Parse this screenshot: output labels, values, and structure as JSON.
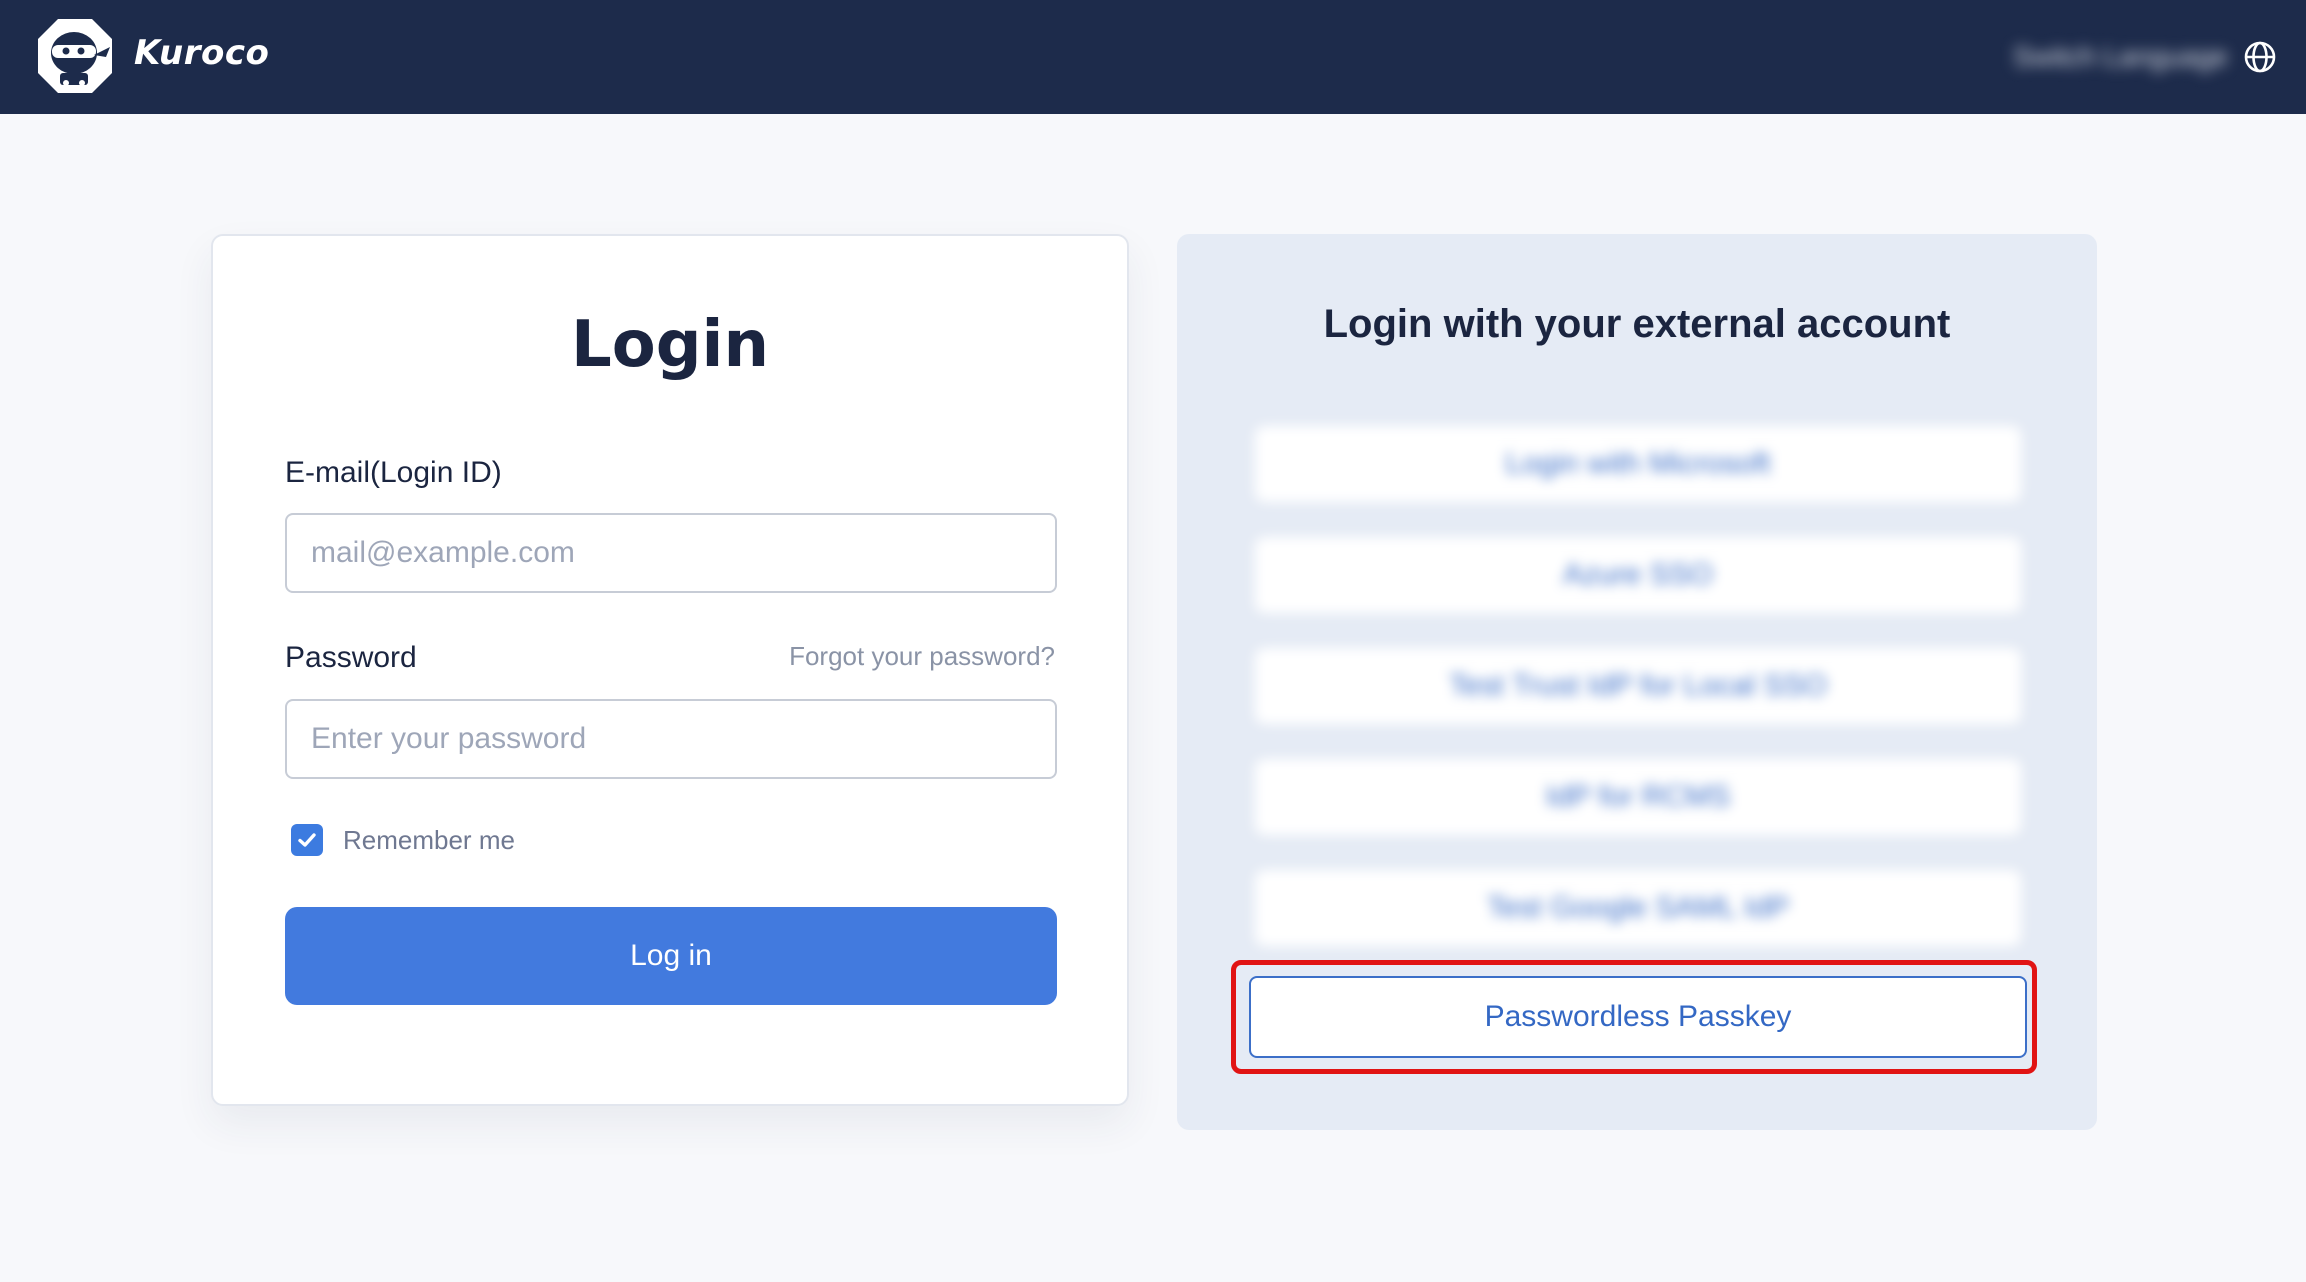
{
  "header": {
    "brand": "Kuroco",
    "language_label": "Switch Language"
  },
  "login": {
    "title": "Login",
    "email_label": "E-mail(Login ID)",
    "email_placeholder": "mail@example.com",
    "email_value": "",
    "password_label": "Password",
    "forgot_link": "Forgot your password?",
    "password_placeholder": "Enter your password",
    "password_value": "",
    "remember_label": "Remember me",
    "remember_checked": true,
    "submit_label": "Log in"
  },
  "external": {
    "title": "Login with your external account",
    "providers": [
      {
        "label": "Login with Microsoft"
      },
      {
        "label": "Azure SSO"
      },
      {
        "label": "Test Trust IdP for Local SSO"
      },
      {
        "label": "IdP for RCMS"
      },
      {
        "label": "Test Google SAML IdP"
      }
    ],
    "passkey_label": "Passwordless Passkey"
  },
  "colors": {
    "header_bg": "#1d2b4b",
    "primary": "#427ade",
    "highlight": "#e11414"
  },
  "icons": {
    "logo": "ninja-logo-icon",
    "language": "globe-icon",
    "checkbox": "check-icon"
  }
}
